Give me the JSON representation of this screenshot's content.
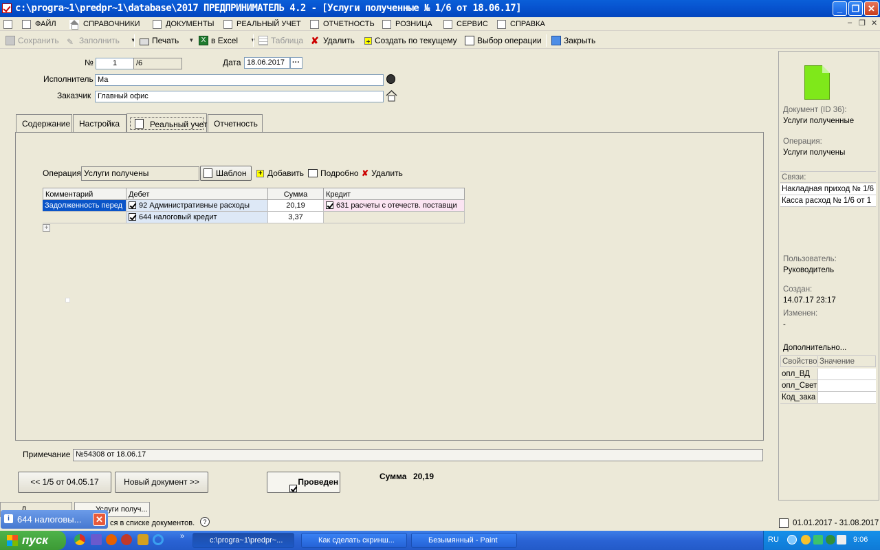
{
  "window": {
    "title": "c:\\progra~1\\predpr~1\\database\\2017  ПРЕДПРИНИМАТЕЛЬ 4.2 - [Услуги полученные № 1/6 от 18.06.17]"
  },
  "menu": {
    "items": [
      "ФАЙЛ",
      "СПРАВОЧНИКИ",
      "ДОКУМЕНТЫ",
      "РЕАЛЬНЫЙ УЧЕТ",
      "ОТЧЕТНОСТЬ",
      "РОЗНИЦА",
      "СЕРВИС",
      "СПРАВКА"
    ]
  },
  "toolbar": {
    "save": "Сохранить",
    "fill": "Заполнить",
    "print": "Печать",
    "excel": "в Excel",
    "table": "Таблица",
    "delete": "Удалить",
    "create_from": "Создать по текущему",
    "choose_op": "Выбор операции",
    "close": "Закрыть"
  },
  "doc": {
    "number_label": "№",
    "number": "1",
    "number_suffix": "/6",
    "date_label": "Дата",
    "date": "18.06.2017",
    "executor_label": "Исполнитель",
    "executor": "Ма",
    "customer_label": "Заказчик",
    "customer": "Главный офис"
  },
  "tabs": [
    "Содержание",
    "Настройка",
    "Реальный учет",
    "Отчетность"
  ],
  "operation": {
    "label": "Операция",
    "value": "Услуги получены",
    "template_btn": "Шаблон",
    "add_btn": "Добавить",
    "detail_btn": "Подробно",
    "delete_btn": "Удалить"
  },
  "grid": {
    "headers": [
      "Комментарий",
      "Дебет",
      "Сумма",
      "Кредит"
    ],
    "rows": [
      {
        "comment": "Задолженность перед",
        "debit": "92 Административные расходы",
        "sum": "20,19",
        "credit": "631  расчеты  с  отечеств. поставщи"
      },
      {
        "comment": "",
        "debit": "644 налоговый кредит",
        "sum": "3,37",
        "credit": ""
      }
    ]
  },
  "note": {
    "label": "Примечание",
    "value": "№54308 от 18.06.17"
  },
  "nav": {
    "prev": "<< 1/5 от 04.05.17",
    "next": "Новый документ >>",
    "posted": "Проведен",
    "sum_label": "Сумма",
    "sum_value": "20,19"
  },
  "side": {
    "doc_label": "Документ  (ID 36):",
    "doc_value": "Услуги полученные",
    "op_label": "Операция:",
    "op_value": "Услуги получены",
    "links_label": "Связи:",
    "links": [
      "Накладная приход № 1/6",
      "Касса расход № 1/6 от 1"
    ],
    "user_label": "Пользователь:",
    "user_value": "Руководитель",
    "created_label": "Создан:",
    "created_value": "14.07.17  23:17",
    "changed_label": "Изменен:",
    "changed_value": "-",
    "extra_label": "Дополнительно...",
    "prop_header": "Свойство",
    "val_header": "Значение",
    "props": [
      "опл_ВД",
      "опл_Свет",
      "Код_зака"
    ]
  },
  "status": {
    "tab1": "Д",
    "tab2": "Услуги получ...",
    "list_text": "ся в списке документов.",
    "period": "01.01.2017 - 31.08.2017",
    "notify": "644 налоговы..."
  },
  "taskbar": {
    "start": "пуск",
    "tasks": [
      "c:\\progra~1\\predpr~...",
      "Как сделать скринш...",
      "Безымянный - Paint"
    ],
    "lang": "RU",
    "clock": "9:06"
  }
}
